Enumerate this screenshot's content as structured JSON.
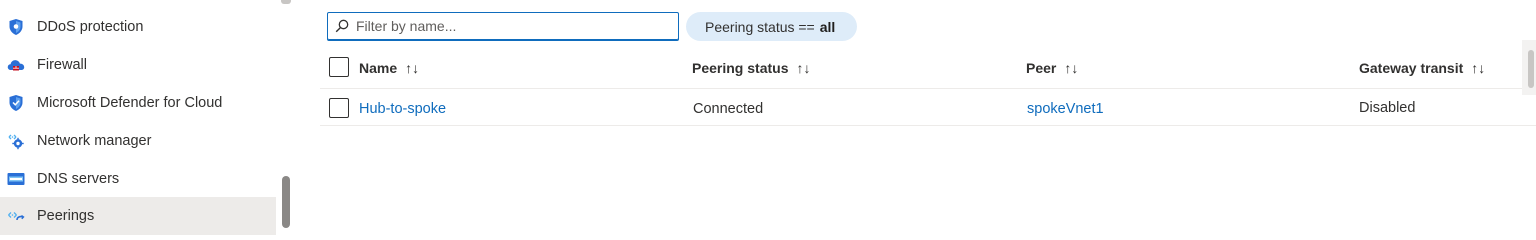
{
  "sidebar": {
    "items": [
      {
        "label": "DDoS protection",
        "icon": "shield-icon"
      },
      {
        "label": "Firewall",
        "icon": "firewall-icon"
      },
      {
        "label": "Microsoft Defender for Cloud",
        "icon": "defender-shield-icon"
      },
      {
        "label": "Network manager",
        "icon": "network-manager-icon"
      },
      {
        "label": "DNS servers",
        "icon": "dns-servers-icon"
      },
      {
        "label": "Peerings",
        "icon": "peerings-icon",
        "selected": true
      }
    ]
  },
  "toolbar": {
    "filter_placeholder": "Filter by name...",
    "filter_value": "",
    "pill_label": "Peering status ==",
    "pill_value": "all"
  },
  "table": {
    "columns": [
      {
        "label": "Name",
        "sort_icon": "↑↓"
      },
      {
        "label": "Peering status",
        "sort_icon": "↑↓"
      },
      {
        "label": "Peer",
        "sort_icon": "↑↓"
      },
      {
        "label": "Gateway transit",
        "sort_icon": "↑↓"
      }
    ],
    "rows": [
      {
        "name": "Hub-to-spoke",
        "peering_status": "Connected",
        "peer": "spokeVnet1",
        "gateway_transit": "Disabled"
      }
    ]
  },
  "colors": {
    "link": "#0f6cbd",
    "pill_bg": "#deecf9",
    "selected_nav_bg": "#edebe9"
  }
}
